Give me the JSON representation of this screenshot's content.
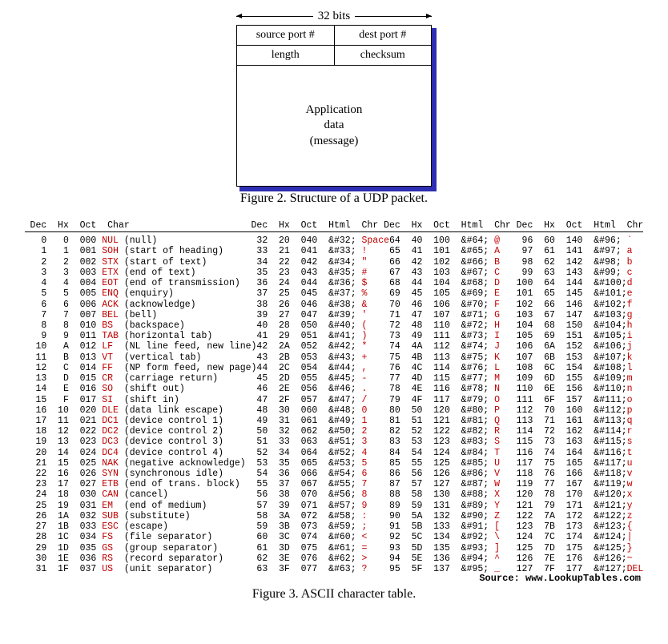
{
  "udp": {
    "bits_label": "32 bits",
    "row1": {
      "left": "source port #",
      "right": "dest port #"
    },
    "row2": {
      "left": "length",
      "right": "checksum"
    },
    "body_l1": "Application",
    "body_l2": "data",
    "body_l3": "(message)",
    "caption": "Figure 2. Structure of a UDP packet."
  },
  "ascii": {
    "headers": {
      "col0": {
        "dec": "Dec",
        "hx": "Hx",
        "oct": "Oct",
        "char": "Char"
      },
      "col1": {
        "dec": "Dec",
        "hx": "Hx",
        "oct": "Oct",
        "html": "Html",
        "chr": "Chr"
      },
      "col2": {
        "dec": "Dec",
        "hx": "Hx",
        "oct": "Oct",
        "html": "Html",
        "chr": "Chr"
      },
      "col3": {
        "dec": "Dec",
        "hx": "Hx",
        "oct": "Oct",
        "html": "Html",
        "chr": "Chr"
      }
    },
    "col0": [
      {
        "dec": 0,
        "hx": "0",
        "oct": "000",
        "mnm": "NUL",
        "desc": "(null)"
      },
      {
        "dec": 1,
        "hx": "1",
        "oct": "001",
        "mnm": "SOH",
        "desc": "(start of heading)"
      },
      {
        "dec": 2,
        "hx": "2",
        "oct": "002",
        "mnm": "STX",
        "desc": "(start of text)"
      },
      {
        "dec": 3,
        "hx": "3",
        "oct": "003",
        "mnm": "ETX",
        "desc": "(end of text)"
      },
      {
        "dec": 4,
        "hx": "4",
        "oct": "004",
        "mnm": "EOT",
        "desc": "(end of transmission)"
      },
      {
        "dec": 5,
        "hx": "5",
        "oct": "005",
        "mnm": "ENQ",
        "desc": "(enquiry)"
      },
      {
        "dec": 6,
        "hx": "6",
        "oct": "006",
        "mnm": "ACK",
        "desc": "(acknowledge)"
      },
      {
        "dec": 7,
        "hx": "7",
        "oct": "007",
        "mnm": "BEL",
        "desc": "(bell)"
      },
      {
        "dec": 8,
        "hx": "8",
        "oct": "010",
        "mnm": "BS",
        "desc": "(backspace)"
      },
      {
        "dec": 9,
        "hx": "9",
        "oct": "011",
        "mnm": "TAB",
        "desc": "(horizontal tab)"
      },
      {
        "dec": 10,
        "hx": "A",
        "oct": "012",
        "mnm": "LF",
        "desc": "(NL line feed, new line)"
      },
      {
        "dec": 11,
        "hx": "B",
        "oct": "013",
        "mnm": "VT",
        "desc": "(vertical tab)"
      },
      {
        "dec": 12,
        "hx": "C",
        "oct": "014",
        "mnm": "FF",
        "desc": "(NP form feed, new page)"
      },
      {
        "dec": 13,
        "hx": "D",
        "oct": "015",
        "mnm": "CR",
        "desc": "(carriage return)"
      },
      {
        "dec": 14,
        "hx": "E",
        "oct": "016",
        "mnm": "SO",
        "desc": "(shift out)"
      },
      {
        "dec": 15,
        "hx": "F",
        "oct": "017",
        "mnm": "SI",
        "desc": "(shift in)"
      },
      {
        "dec": 16,
        "hx": "10",
        "oct": "020",
        "mnm": "DLE",
        "desc": "(data link escape)"
      },
      {
        "dec": 17,
        "hx": "11",
        "oct": "021",
        "mnm": "DC1",
        "desc": "(device control 1)"
      },
      {
        "dec": 18,
        "hx": "12",
        "oct": "022",
        "mnm": "DC2",
        "desc": "(device control 2)"
      },
      {
        "dec": 19,
        "hx": "13",
        "oct": "023",
        "mnm": "DC3",
        "desc": "(device control 3)"
      },
      {
        "dec": 20,
        "hx": "14",
        "oct": "024",
        "mnm": "DC4",
        "desc": "(device control 4)"
      },
      {
        "dec": 21,
        "hx": "15",
        "oct": "025",
        "mnm": "NAK",
        "desc": "(negative acknowledge)"
      },
      {
        "dec": 22,
        "hx": "16",
        "oct": "026",
        "mnm": "SYN",
        "desc": "(synchronous idle)"
      },
      {
        "dec": 23,
        "hx": "17",
        "oct": "027",
        "mnm": "ETB",
        "desc": "(end of trans. block)"
      },
      {
        "dec": 24,
        "hx": "18",
        "oct": "030",
        "mnm": "CAN",
        "desc": "(cancel)"
      },
      {
        "dec": 25,
        "hx": "19",
        "oct": "031",
        "mnm": "EM",
        "desc": "(end of medium)"
      },
      {
        "dec": 26,
        "hx": "1A",
        "oct": "032",
        "mnm": "SUB",
        "desc": "(substitute)"
      },
      {
        "dec": 27,
        "hx": "1B",
        "oct": "033",
        "mnm": "ESC",
        "desc": "(escape)"
      },
      {
        "dec": 28,
        "hx": "1C",
        "oct": "034",
        "mnm": "FS",
        "desc": "(file separator)"
      },
      {
        "dec": 29,
        "hx": "1D",
        "oct": "035",
        "mnm": "GS",
        "desc": "(group separator)"
      },
      {
        "dec": 30,
        "hx": "1E",
        "oct": "036",
        "mnm": "RS",
        "desc": "(record separator)"
      },
      {
        "dec": 31,
        "hx": "1F",
        "oct": "037",
        "mnm": "US",
        "desc": "(unit separator)"
      }
    ],
    "col1": [
      {
        "dec": 32,
        "hx": "20",
        "oct": "040",
        "html": "&#32;",
        "chr": "Space"
      },
      {
        "dec": 33,
        "hx": "21",
        "oct": "041",
        "html": "&#33;",
        "chr": "!"
      },
      {
        "dec": 34,
        "hx": "22",
        "oct": "042",
        "html": "&#34;",
        "chr": "\""
      },
      {
        "dec": 35,
        "hx": "23",
        "oct": "043",
        "html": "&#35;",
        "chr": "#"
      },
      {
        "dec": 36,
        "hx": "24",
        "oct": "044",
        "html": "&#36;",
        "chr": "$"
      },
      {
        "dec": 37,
        "hx": "25",
        "oct": "045",
        "html": "&#37;",
        "chr": "%"
      },
      {
        "dec": 38,
        "hx": "26",
        "oct": "046",
        "html": "&#38;",
        "chr": "&"
      },
      {
        "dec": 39,
        "hx": "27",
        "oct": "047",
        "html": "&#39;",
        "chr": "'"
      },
      {
        "dec": 40,
        "hx": "28",
        "oct": "050",
        "html": "&#40;",
        "chr": "("
      },
      {
        "dec": 41,
        "hx": "29",
        "oct": "051",
        "html": "&#41;",
        "chr": ")"
      },
      {
        "dec": 42,
        "hx": "2A",
        "oct": "052",
        "html": "&#42;",
        "chr": "*"
      },
      {
        "dec": 43,
        "hx": "2B",
        "oct": "053",
        "html": "&#43;",
        "chr": "+"
      },
      {
        "dec": 44,
        "hx": "2C",
        "oct": "054",
        "html": "&#44;",
        "chr": ","
      },
      {
        "dec": 45,
        "hx": "2D",
        "oct": "055",
        "html": "&#45;",
        "chr": "-"
      },
      {
        "dec": 46,
        "hx": "2E",
        "oct": "056",
        "html": "&#46;",
        "chr": "."
      },
      {
        "dec": 47,
        "hx": "2F",
        "oct": "057",
        "html": "&#47;",
        "chr": "/"
      },
      {
        "dec": 48,
        "hx": "30",
        "oct": "060",
        "html": "&#48;",
        "chr": "0"
      },
      {
        "dec": 49,
        "hx": "31",
        "oct": "061",
        "html": "&#49;",
        "chr": "1"
      },
      {
        "dec": 50,
        "hx": "32",
        "oct": "062",
        "html": "&#50;",
        "chr": "2"
      },
      {
        "dec": 51,
        "hx": "33",
        "oct": "063",
        "html": "&#51;",
        "chr": "3"
      },
      {
        "dec": 52,
        "hx": "34",
        "oct": "064",
        "html": "&#52;",
        "chr": "4"
      },
      {
        "dec": 53,
        "hx": "35",
        "oct": "065",
        "html": "&#53;",
        "chr": "5"
      },
      {
        "dec": 54,
        "hx": "36",
        "oct": "066",
        "html": "&#54;",
        "chr": "6"
      },
      {
        "dec": 55,
        "hx": "37",
        "oct": "067",
        "html": "&#55;",
        "chr": "7"
      },
      {
        "dec": 56,
        "hx": "38",
        "oct": "070",
        "html": "&#56;",
        "chr": "8"
      },
      {
        "dec": 57,
        "hx": "39",
        "oct": "071",
        "html": "&#57;",
        "chr": "9"
      },
      {
        "dec": 58,
        "hx": "3A",
        "oct": "072",
        "html": "&#58;",
        "chr": ":"
      },
      {
        "dec": 59,
        "hx": "3B",
        "oct": "073",
        "html": "&#59;",
        "chr": ";"
      },
      {
        "dec": 60,
        "hx": "3C",
        "oct": "074",
        "html": "&#60;",
        "chr": "<"
      },
      {
        "dec": 61,
        "hx": "3D",
        "oct": "075",
        "html": "&#61;",
        "chr": "="
      },
      {
        "dec": 62,
        "hx": "3E",
        "oct": "076",
        "html": "&#62;",
        "chr": ">"
      },
      {
        "dec": 63,
        "hx": "3F",
        "oct": "077",
        "html": "&#63;",
        "chr": "?"
      }
    ],
    "col2": [
      {
        "dec": 64,
        "hx": "40",
        "oct": "100",
        "html": "&#64;",
        "chr": "@"
      },
      {
        "dec": 65,
        "hx": "41",
        "oct": "101",
        "html": "&#65;",
        "chr": "A"
      },
      {
        "dec": 66,
        "hx": "42",
        "oct": "102",
        "html": "&#66;",
        "chr": "B"
      },
      {
        "dec": 67,
        "hx": "43",
        "oct": "103",
        "html": "&#67;",
        "chr": "C"
      },
      {
        "dec": 68,
        "hx": "44",
        "oct": "104",
        "html": "&#68;",
        "chr": "D"
      },
      {
        "dec": 69,
        "hx": "45",
        "oct": "105",
        "html": "&#69;",
        "chr": "E"
      },
      {
        "dec": 70,
        "hx": "46",
        "oct": "106",
        "html": "&#70;",
        "chr": "F"
      },
      {
        "dec": 71,
        "hx": "47",
        "oct": "107",
        "html": "&#71;",
        "chr": "G"
      },
      {
        "dec": 72,
        "hx": "48",
        "oct": "110",
        "html": "&#72;",
        "chr": "H"
      },
      {
        "dec": 73,
        "hx": "49",
        "oct": "111",
        "html": "&#73;",
        "chr": "I"
      },
      {
        "dec": 74,
        "hx": "4A",
        "oct": "112",
        "html": "&#74;",
        "chr": "J"
      },
      {
        "dec": 75,
        "hx": "4B",
        "oct": "113",
        "html": "&#75;",
        "chr": "K"
      },
      {
        "dec": 76,
        "hx": "4C",
        "oct": "114",
        "html": "&#76;",
        "chr": "L"
      },
      {
        "dec": 77,
        "hx": "4D",
        "oct": "115",
        "html": "&#77;",
        "chr": "M"
      },
      {
        "dec": 78,
        "hx": "4E",
        "oct": "116",
        "html": "&#78;",
        "chr": "N"
      },
      {
        "dec": 79,
        "hx": "4F",
        "oct": "117",
        "html": "&#79;",
        "chr": "O"
      },
      {
        "dec": 80,
        "hx": "50",
        "oct": "120",
        "html": "&#80;",
        "chr": "P"
      },
      {
        "dec": 81,
        "hx": "51",
        "oct": "121",
        "html": "&#81;",
        "chr": "Q"
      },
      {
        "dec": 82,
        "hx": "52",
        "oct": "122",
        "html": "&#82;",
        "chr": "R"
      },
      {
        "dec": 83,
        "hx": "53",
        "oct": "123",
        "html": "&#83;",
        "chr": "S"
      },
      {
        "dec": 84,
        "hx": "54",
        "oct": "124",
        "html": "&#84;",
        "chr": "T"
      },
      {
        "dec": 85,
        "hx": "55",
        "oct": "125",
        "html": "&#85;",
        "chr": "U"
      },
      {
        "dec": 86,
        "hx": "56",
        "oct": "126",
        "html": "&#86;",
        "chr": "V"
      },
      {
        "dec": 87,
        "hx": "57",
        "oct": "127",
        "html": "&#87;",
        "chr": "W"
      },
      {
        "dec": 88,
        "hx": "58",
        "oct": "130",
        "html": "&#88;",
        "chr": "X"
      },
      {
        "dec": 89,
        "hx": "59",
        "oct": "131",
        "html": "&#89;",
        "chr": "Y"
      },
      {
        "dec": 90,
        "hx": "5A",
        "oct": "132",
        "html": "&#90;",
        "chr": "Z"
      },
      {
        "dec": 91,
        "hx": "5B",
        "oct": "133",
        "html": "&#91;",
        "chr": "["
      },
      {
        "dec": 92,
        "hx": "5C",
        "oct": "134",
        "html": "&#92;",
        "chr": "\\"
      },
      {
        "dec": 93,
        "hx": "5D",
        "oct": "135",
        "html": "&#93;",
        "chr": "]"
      },
      {
        "dec": 94,
        "hx": "5E",
        "oct": "136",
        "html": "&#94;",
        "chr": "^"
      },
      {
        "dec": 95,
        "hx": "5F",
        "oct": "137",
        "html": "&#95;",
        "chr": "_"
      }
    ],
    "col3": [
      {
        "dec": 96,
        "hx": "60",
        "oct": "140",
        "html": "&#96;",
        "chr": "`"
      },
      {
        "dec": 97,
        "hx": "61",
        "oct": "141",
        "html": "&#97;",
        "chr": "a"
      },
      {
        "dec": 98,
        "hx": "62",
        "oct": "142",
        "html": "&#98;",
        "chr": "b"
      },
      {
        "dec": 99,
        "hx": "63",
        "oct": "143",
        "html": "&#99;",
        "chr": "c"
      },
      {
        "dec": 100,
        "hx": "64",
        "oct": "144",
        "html": "&#100;",
        "chr": "d"
      },
      {
        "dec": 101,
        "hx": "65",
        "oct": "145",
        "html": "&#101;",
        "chr": "e"
      },
      {
        "dec": 102,
        "hx": "66",
        "oct": "146",
        "html": "&#102;",
        "chr": "f"
      },
      {
        "dec": 103,
        "hx": "67",
        "oct": "147",
        "html": "&#103;",
        "chr": "g"
      },
      {
        "dec": 104,
        "hx": "68",
        "oct": "150",
        "html": "&#104;",
        "chr": "h"
      },
      {
        "dec": 105,
        "hx": "69",
        "oct": "151",
        "html": "&#105;",
        "chr": "i"
      },
      {
        "dec": 106,
        "hx": "6A",
        "oct": "152",
        "html": "&#106;",
        "chr": "j"
      },
      {
        "dec": 107,
        "hx": "6B",
        "oct": "153",
        "html": "&#107;",
        "chr": "k"
      },
      {
        "dec": 108,
        "hx": "6C",
        "oct": "154",
        "html": "&#108;",
        "chr": "l"
      },
      {
        "dec": 109,
        "hx": "6D",
        "oct": "155",
        "html": "&#109;",
        "chr": "m"
      },
      {
        "dec": 110,
        "hx": "6E",
        "oct": "156",
        "html": "&#110;",
        "chr": "n"
      },
      {
        "dec": 111,
        "hx": "6F",
        "oct": "157",
        "html": "&#111;",
        "chr": "o"
      },
      {
        "dec": 112,
        "hx": "70",
        "oct": "160",
        "html": "&#112;",
        "chr": "p"
      },
      {
        "dec": 113,
        "hx": "71",
        "oct": "161",
        "html": "&#113;",
        "chr": "q"
      },
      {
        "dec": 114,
        "hx": "72",
        "oct": "162",
        "html": "&#114;",
        "chr": "r"
      },
      {
        "dec": 115,
        "hx": "73",
        "oct": "163",
        "html": "&#115;",
        "chr": "s"
      },
      {
        "dec": 116,
        "hx": "74",
        "oct": "164",
        "html": "&#116;",
        "chr": "t"
      },
      {
        "dec": 117,
        "hx": "75",
        "oct": "165",
        "html": "&#117;",
        "chr": "u"
      },
      {
        "dec": 118,
        "hx": "76",
        "oct": "166",
        "html": "&#118;",
        "chr": "v"
      },
      {
        "dec": 119,
        "hx": "77",
        "oct": "167",
        "html": "&#119;",
        "chr": "w"
      },
      {
        "dec": 120,
        "hx": "78",
        "oct": "170",
        "html": "&#120;",
        "chr": "x"
      },
      {
        "dec": 121,
        "hx": "79",
        "oct": "171",
        "html": "&#121;",
        "chr": "y"
      },
      {
        "dec": 122,
        "hx": "7A",
        "oct": "172",
        "html": "&#122;",
        "chr": "z"
      },
      {
        "dec": 123,
        "hx": "7B",
        "oct": "173",
        "html": "&#123;",
        "chr": "{"
      },
      {
        "dec": 124,
        "hx": "7C",
        "oct": "174",
        "html": "&#124;",
        "chr": "|"
      },
      {
        "dec": 125,
        "hx": "7D",
        "oct": "175",
        "html": "&#125;",
        "chr": "}"
      },
      {
        "dec": 126,
        "hx": "7E",
        "oct": "176",
        "html": "&#126;",
        "chr": "~"
      },
      {
        "dec": 127,
        "hx": "7F",
        "oct": "177",
        "html": "&#127;",
        "chr": "DEL"
      }
    ],
    "caption": "Figure 3. ASCII character table.",
    "source": "Source:  www.LookupTables.com"
  }
}
